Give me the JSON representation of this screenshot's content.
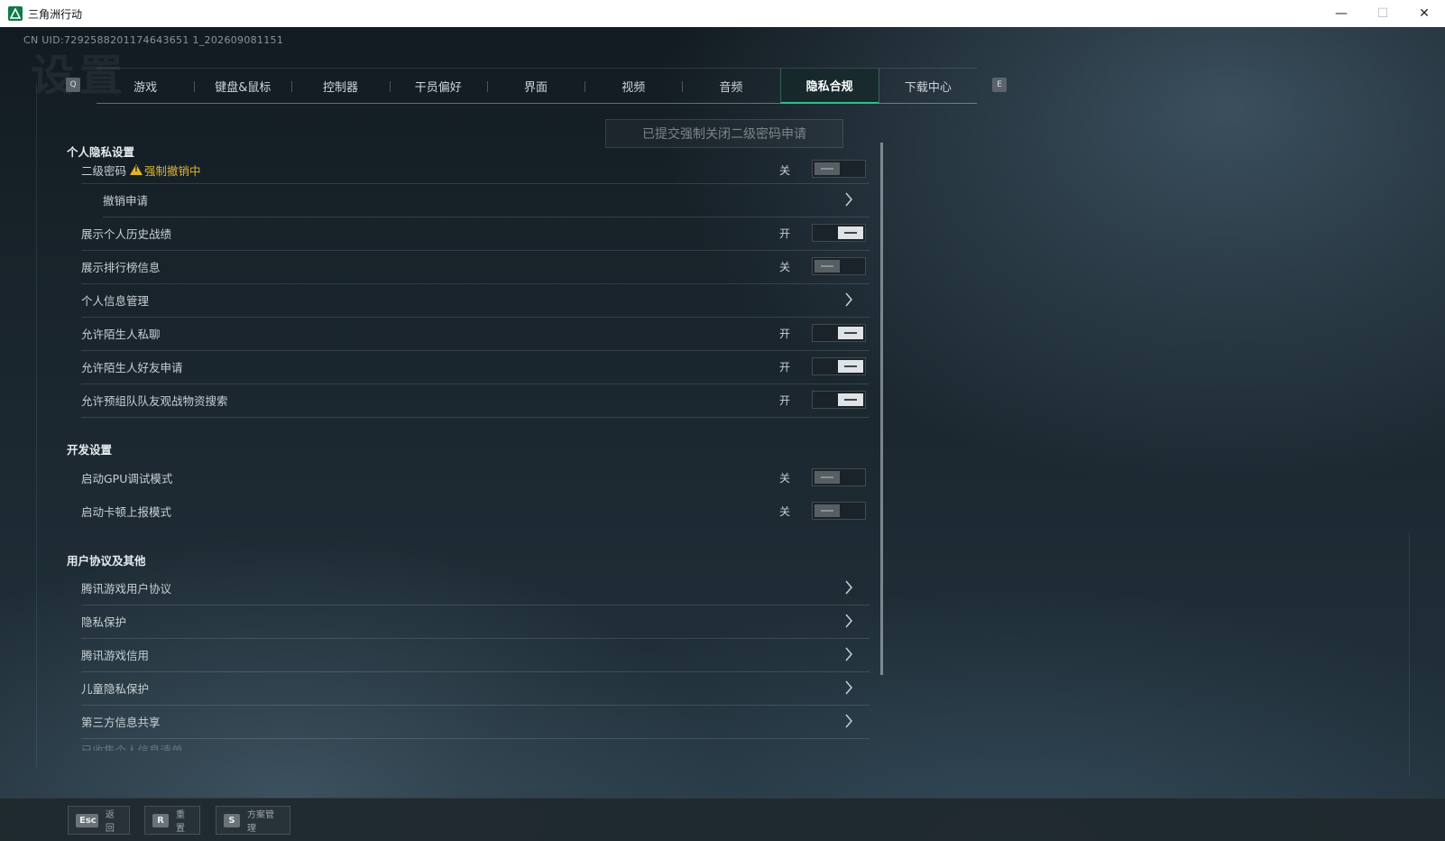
{
  "window": {
    "title": "三角洲行动",
    "controls": {
      "minimize": "—",
      "maximize": "☐",
      "close": "✕"
    }
  },
  "uid_text": "CN UID:7292588201174643651 1_202609081151",
  "background_title": "设置",
  "tabs": {
    "left_key": "Q",
    "right_key": "E",
    "items": [
      "游戏",
      "键盘&鼠标",
      "控制器",
      "干员偏好",
      "界面",
      "视频",
      "音频",
      "隐私合规",
      "下载中心"
    ],
    "active": "隐私合规"
  },
  "notice": "已提交强制关闭二级密码申请",
  "sections": {
    "privacy": {
      "title": "个人隐私设置",
      "secondary_password": {
        "label": "二级密码",
        "warning": "强制撤销中",
        "state": "关"
      },
      "revoke_request": {
        "label": "撤销申请"
      },
      "show_history": {
        "label": "展示个人历史战绩",
        "state": "开"
      },
      "show_ranking": {
        "label": "展示排行榜信息",
        "state": "关"
      },
      "personal_info": {
        "label": "个人信息管理"
      },
      "stranger_chat": {
        "label": "允许陌生人私聊",
        "state": "开"
      },
      "stranger_friend": {
        "label": "允许陌生人好友申请",
        "state": "开"
      },
      "team_search": {
        "label": "允许预组队队友观战物资搜索",
        "state": "开"
      }
    },
    "dev": {
      "title": "开发设置",
      "gpu_debug": {
        "label": "启动GPU调试模式",
        "state": "关"
      },
      "stutter_report": {
        "label": "启动卡顿上报模式",
        "state": "关"
      }
    },
    "agreements": {
      "title": "用户协议及其他",
      "items": [
        "腾讯游戏用户协议",
        "隐私保护",
        "腾讯游戏信用",
        "儿童隐私保护",
        "第三方信息共享",
        "已收集个人信息清单"
      ]
    }
  },
  "bottom": {
    "back": {
      "key": "Esc",
      "label": "返回"
    },
    "reset": {
      "key": "R",
      "label": "重置"
    },
    "scheme": {
      "key": "S",
      "label": "方案管理"
    }
  }
}
